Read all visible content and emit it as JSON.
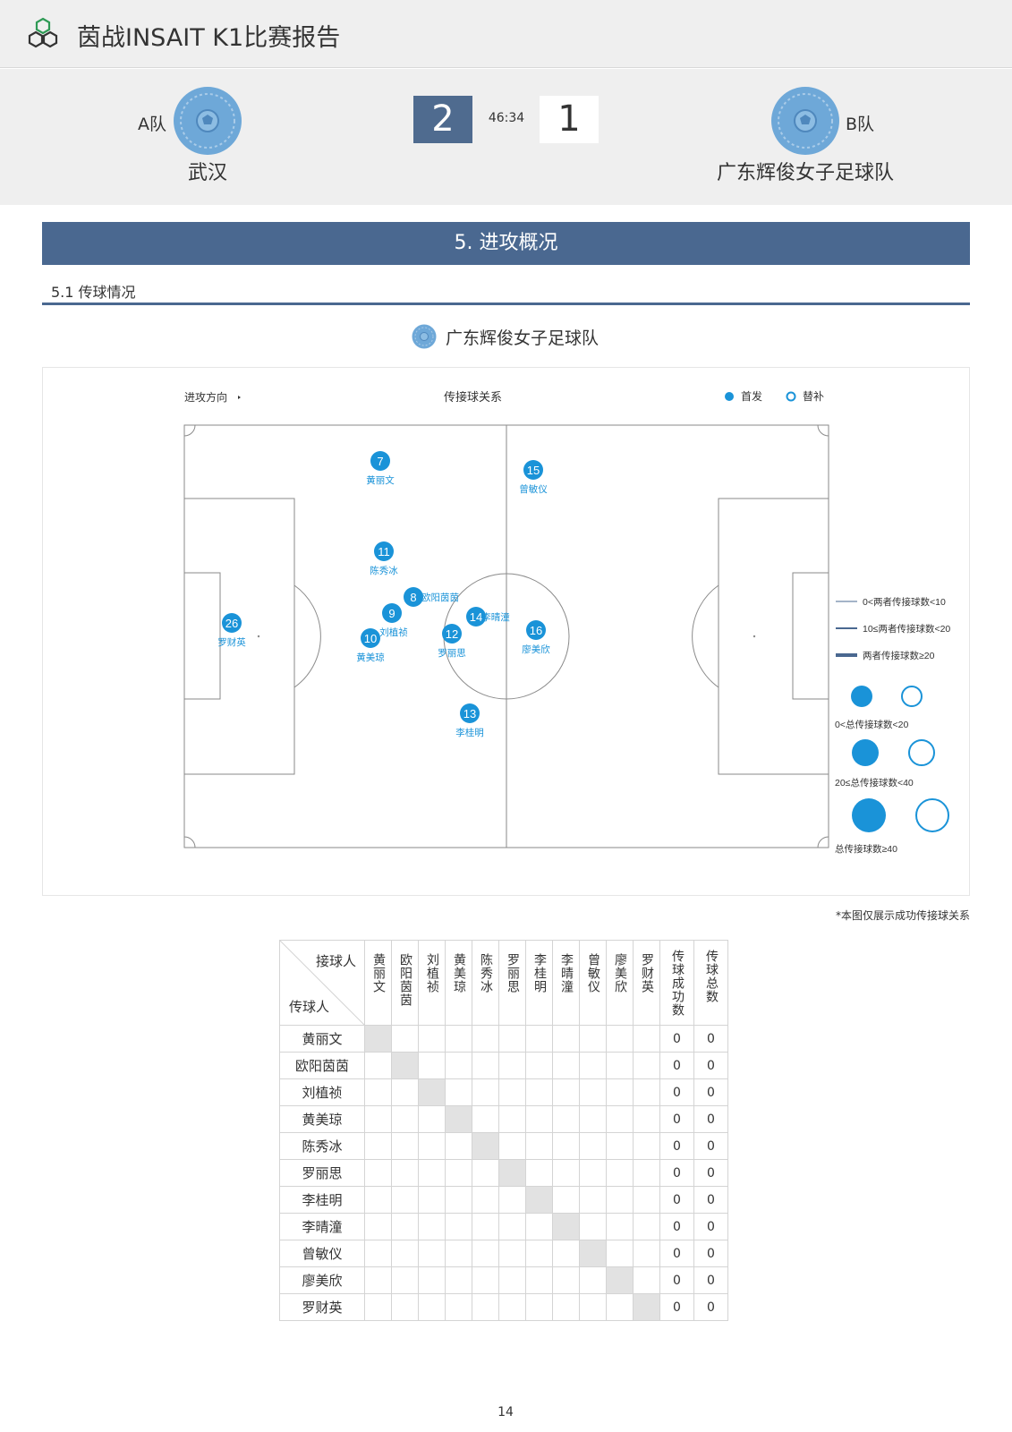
{
  "header": {
    "title": "茵战INSAIT K1比赛报告"
  },
  "match": {
    "home": {
      "tag": "A队",
      "name": "武汉",
      "score": "2"
    },
    "away": {
      "tag": "B队",
      "name": "广东辉俊女子足球队",
      "score": "1"
    },
    "time": "46:34"
  },
  "section": {
    "title": "5. 进攻概况",
    "subsection": "5.1 传球情况",
    "team_name": "广东辉俊女子足球队"
  },
  "pitch": {
    "direction_label": "进攻方向",
    "title": "传接球关系",
    "legend_starter": "首发",
    "legend_sub": "替补",
    "line_legend": [
      "0<两者传接球数<10",
      "10≤两者传接球数<20",
      "两者传接球数≥20"
    ],
    "size_legend": [
      "0<总传接球数<20",
      "20≤总传接球数<40",
      "总传接球数≥40"
    ],
    "players": [
      {
        "number": "7",
        "name": "黄丽文"
      },
      {
        "number": "15",
        "name": "曾敏仪"
      },
      {
        "number": "11",
        "name": "陈秀冰"
      },
      {
        "number": "8",
        "name": "欧阳茵茵"
      },
      {
        "number": "9",
        "name": "刘植祯"
      },
      {
        "number": "14",
        "name": "李晴潼"
      },
      {
        "number": "12",
        "name": "罗丽思"
      },
      {
        "number": "10",
        "name": "黄美琼"
      },
      {
        "number": "16",
        "name": "廖美欣"
      },
      {
        "number": "26",
        "name": "罗财英"
      },
      {
        "number": "13",
        "name": "李桂明"
      }
    ],
    "colors": {
      "starter": "#1a93d8",
      "pitch_line": "#8a8a8a",
      "line_legend": "#4a6890"
    }
  },
  "footnote": "*本图仅展示成功传接球关系",
  "matrix": {
    "receiver_label": "接球人",
    "passer_label": "传球人",
    "players": [
      "黄丽文",
      "欧阳茵茵",
      "刘植祯",
      "黄美琼",
      "陈秀冰",
      "罗丽思",
      "李桂明",
      "李晴潼",
      "曾敏仪",
      "廖美欣",
      "罗财英"
    ],
    "success_label": "传球成功数",
    "total_label": "传球总数",
    "success": [
      "0",
      "0",
      "0",
      "0",
      "0",
      "0",
      "0",
      "0",
      "0",
      "0",
      "0"
    ],
    "total": [
      "0",
      "0",
      "0",
      "0",
      "0",
      "0",
      "0",
      "0",
      "0",
      "0",
      "0"
    ]
  },
  "page_number": "14"
}
